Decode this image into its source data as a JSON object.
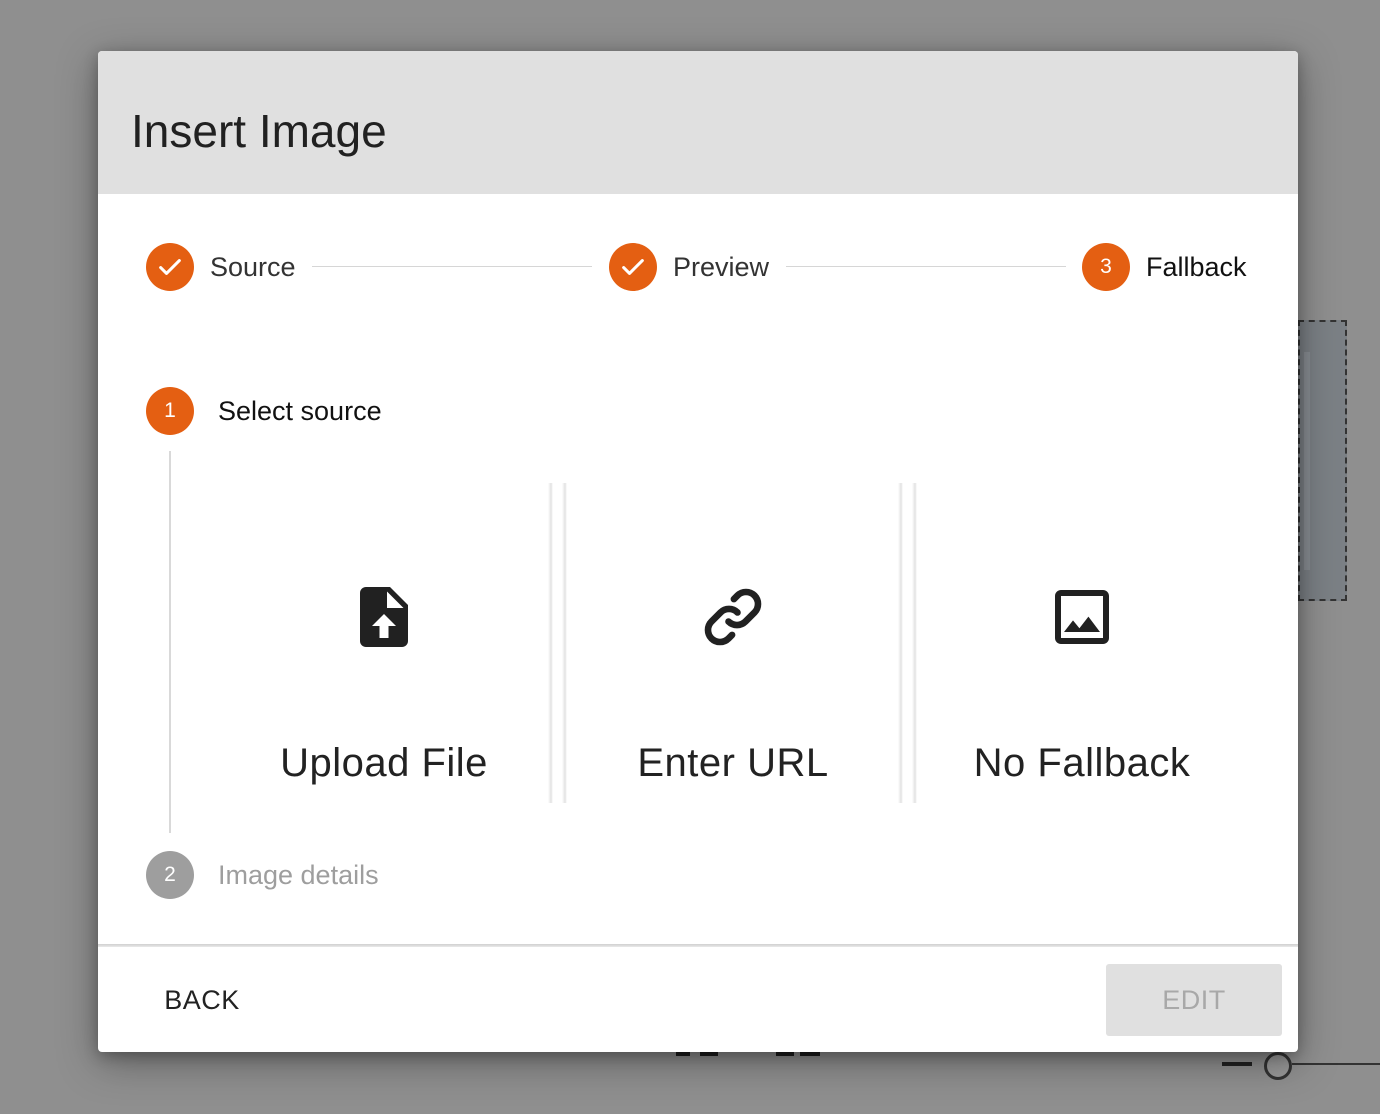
{
  "dialog": {
    "title": "Insert Image"
  },
  "stepper": {
    "steps": [
      {
        "label": "Source",
        "state": "completed"
      },
      {
        "label": "Preview",
        "state": "completed"
      },
      {
        "label": "Fallback",
        "state": "active",
        "number": "3"
      }
    ]
  },
  "substeps": [
    {
      "number": "1",
      "label": "Select source",
      "state": "active"
    },
    {
      "number": "2",
      "label": "Image details",
      "state": "disabled"
    }
  ],
  "options": [
    {
      "label": "Upload File",
      "icon": "upload-file-icon"
    },
    {
      "label": "Enter URL",
      "icon": "link-icon"
    },
    {
      "label": "No Fallback",
      "icon": "image-icon"
    }
  ],
  "footer": {
    "back_label": "BACK",
    "edit_label": "EDIT"
  },
  "colors": {
    "accent": "#e45f12",
    "disabled": "#9e9e9e",
    "header_bg": "#e0e0e0"
  }
}
